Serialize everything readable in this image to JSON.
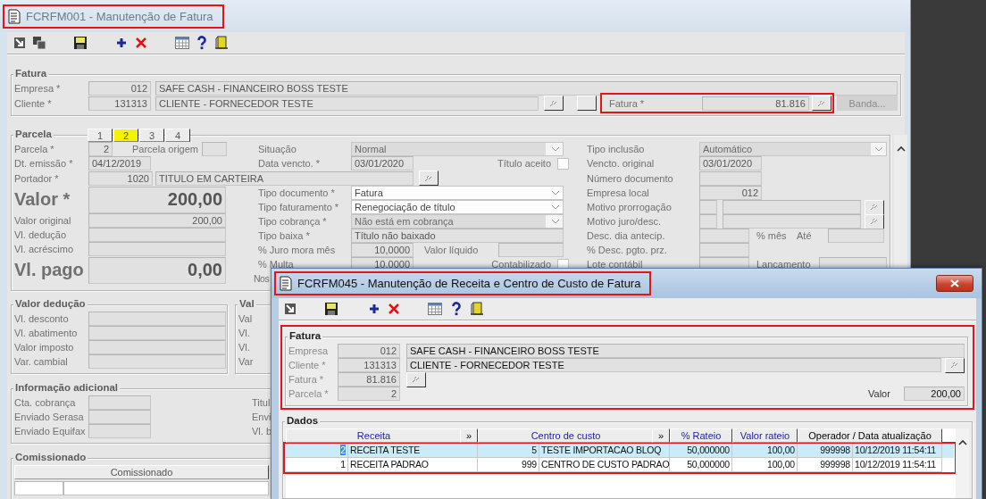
{
  "main_window": {
    "title": "FCRFM001 - Manutenção de Fatura",
    "title_highlighted": true,
    "fatura": {
      "legend": "Fatura",
      "empresa": {
        "label": "Empresa *",
        "code": "012",
        "name": "SAFE CASH - FINANCEIRO BOSS TESTE"
      },
      "cliente": {
        "label": "Cliente *",
        "code": "131313",
        "name": "CLIENTE - FORNECEDOR TESTE"
      },
      "fatura": {
        "label": "Fatura *",
        "value": "81.816",
        "highlighted": true
      },
      "banda_button": {
        "label": "Banda...",
        "disabled": true
      }
    },
    "parcela": {
      "legend": "Parcela",
      "tabs": [
        {
          "label": "1",
          "selected": false
        },
        {
          "label": "2",
          "selected": true
        },
        {
          "label": "3",
          "selected": false
        },
        {
          "label": "4",
          "selected": false
        }
      ],
      "parcela": {
        "label": "Parcela *",
        "value": "2",
        "origem_label": "Parcela origem"
      },
      "dt_emissao": {
        "label": "Dt. emissão *",
        "value": "04/12/2019"
      },
      "portador": {
        "label": "Portador *",
        "code": "1020",
        "name": "TITULO EM CARTEIRA"
      },
      "valor": {
        "label": "Valor *",
        "value": "200,00"
      },
      "valor_original": {
        "label": "Valor original",
        "value": "200,00"
      },
      "vl_deducao": {
        "label": "Vl. dedução"
      },
      "vl_acrescimo": {
        "label": "Vl. acréscimo"
      },
      "vl_pago": {
        "label": "Vl. pago",
        "value": "0,00"
      },
      "situacao": {
        "label": "Situação",
        "value": "Normal",
        "disabled": true
      },
      "data_vencto": {
        "label": "Data vencto. *",
        "value": "03/01/2020"
      },
      "titulo_aceito": {
        "label": "Título aceito",
        "checked": false
      },
      "tipo_documento": {
        "label": "Tipo documento *",
        "value": "Fatura",
        "disabled": false
      },
      "tipo_faturamento": {
        "label": "Tipo faturamento *",
        "value": "Renegociação de título",
        "disabled": false
      },
      "tipo_cobranca": {
        "label": "Tipo cobrança *",
        "value": "Não está em cobrança",
        "disabled": true
      },
      "tipo_baixa": {
        "label": "Tipo baixa *",
        "value": "Título não baixado"
      },
      "juro_mora": {
        "label": "% Juro mora mês",
        "value": "10,0000"
      },
      "valor_liquido": {
        "label": "Valor líquido"
      },
      "multa": {
        "label": "% Multa",
        "value": "10,0000"
      },
      "contabilizado": {
        "label": "Contabilizado",
        "checked": false
      },
      "nosso_numero": {
        "label": "Nos"
      },
      "tipo_inclusao": {
        "label": "Tipo inclusão",
        "value": "Automático",
        "disabled": true
      },
      "vencto_original": {
        "label": "Vencto. original",
        "value": "03/01/2020"
      },
      "numero_documento": {
        "label": "Número documento"
      },
      "empresa_local": {
        "label": "Empresa local",
        "value": "012"
      },
      "motivo_prorrogacao": {
        "label": "Motivo prorrogação"
      },
      "motivo_juro": {
        "label": "Motivo juro/desc."
      },
      "desc_dia": {
        "label": "Desc. dia antecip.",
        "mes_label": "% mês",
        "ate_label": "Até"
      },
      "desc_pgto": {
        "label": "% Desc. pgto. prz."
      },
      "lote_contabil": {
        "label": "Lote contábil",
        "lancamento_label": "Lancamento"
      }
    },
    "valor_deducao": {
      "legend": "Valor dedução",
      "rows": [
        "Vl. desconto",
        "Vl. abatimento",
        "Valor imposto",
        "Var. cambial"
      ]
    },
    "valor_acrescimo": {
      "legend": "Val",
      "rows": [
        "Val",
        "Vl.",
        "Vl.",
        "Var"
      ]
    },
    "informacao": {
      "legend": "Informação adicional",
      "rows": [
        "Cta. cobrança",
        "Enviado Serasa",
        "Enviado Equifax"
      ],
      "right_rows": [
        "Titul",
        "Envi",
        "Vl. b"
      ]
    },
    "comissionado": {
      "legend": "Comissionado",
      "column": "Comissionado"
    }
  },
  "dialog": {
    "title": "FCRFM045 - Manutenção de Receita e Centro de Custo de Fatura",
    "title_highlighted": true,
    "fatura": {
      "legend": "Fatura",
      "highlighted": true,
      "empresa": {
        "label": "Empresa",
        "code": "012",
        "name": "SAFE CASH - FINANCEIRO BOSS TESTE"
      },
      "cliente": {
        "label": "Cliente *",
        "code": "131313",
        "name": "CLIENTE - FORNECEDOR TESTE"
      },
      "fatura": {
        "label": "Fatura *",
        "value": "81.816"
      },
      "parcela": {
        "label": "Parcela *",
        "value": "2"
      },
      "valor": {
        "label": "Valor",
        "value": "200,00"
      }
    },
    "dados": {
      "legend": "Dados",
      "rows_highlighted": true,
      "columns": [
        {
          "label": "Receita",
          "color": "#1c1c9c",
          "button": "»"
        },
        {
          "label": "Centro de custo",
          "color": "#1c1c9c",
          "button": "»"
        },
        {
          "label": "% Rateio",
          "color": "#1c1c9c"
        },
        {
          "label": "Valor rateio",
          "color": "#1c1c9c"
        },
        {
          "label": "Operador / Data atualização",
          "color": "#000000"
        }
      ],
      "rows": [
        {
          "selected": true,
          "cells": [
            [
              "2",
              "RECEITA TESTE"
            ],
            [
              "5",
              "TESTE IMPORTACAO BLOQ"
            ],
            [
              "50,000000"
            ],
            [
              "100,00"
            ],
            [
              "999998",
              "10/12/2019 11:54:11"
            ]
          ]
        },
        {
          "selected": false,
          "cells": [
            [
              "1",
              "RECEITA PADRAO"
            ],
            [
              "999",
              "CENTRO DE CUSTO PADRAO"
            ],
            [
              "50,000000"
            ],
            [
              "100,00"
            ],
            [
              "999998",
              "10/12/2019 11:54:11"
            ]
          ]
        }
      ]
    }
  }
}
